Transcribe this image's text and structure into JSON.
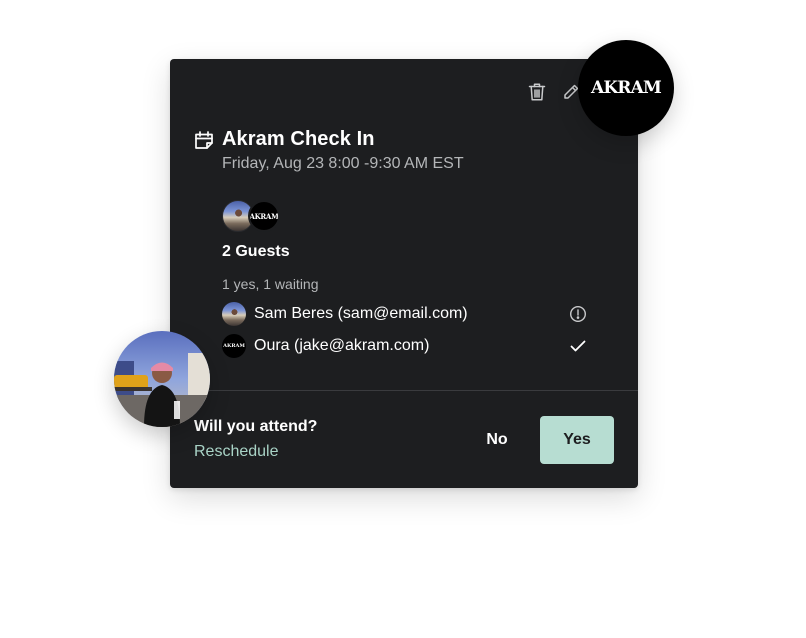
{
  "brand": {
    "logo_text": "AKRAM"
  },
  "event": {
    "title": "Akram Check In",
    "datetime": "Friday, Aug 23 8:00 -9:30 AM EST",
    "icon": "calendar-icon"
  },
  "toolbar": {
    "delete_icon": "trash-icon",
    "edit_icon": "pencil-icon"
  },
  "guests": {
    "count_label": "2 Guests",
    "status_summary": "1 yes, 1 waiting",
    "list": [
      {
        "name": "Sam Beres (sam@email.com)",
        "status_icon": "alert-circle-icon",
        "status": "waiting"
      },
      {
        "name": "Oura (jake@akram.com)",
        "status_icon": "check-icon",
        "status": "yes"
      }
    ]
  },
  "rsvp": {
    "question": "Will you attend?",
    "reschedule_label": "Reschedule",
    "no_label": "No",
    "yes_label": "Yes"
  },
  "colors": {
    "card_background": "#1d1e20",
    "accent": "#b7ddd2",
    "link": "#a9d3c6",
    "muted_text": "#b4b6b8"
  }
}
